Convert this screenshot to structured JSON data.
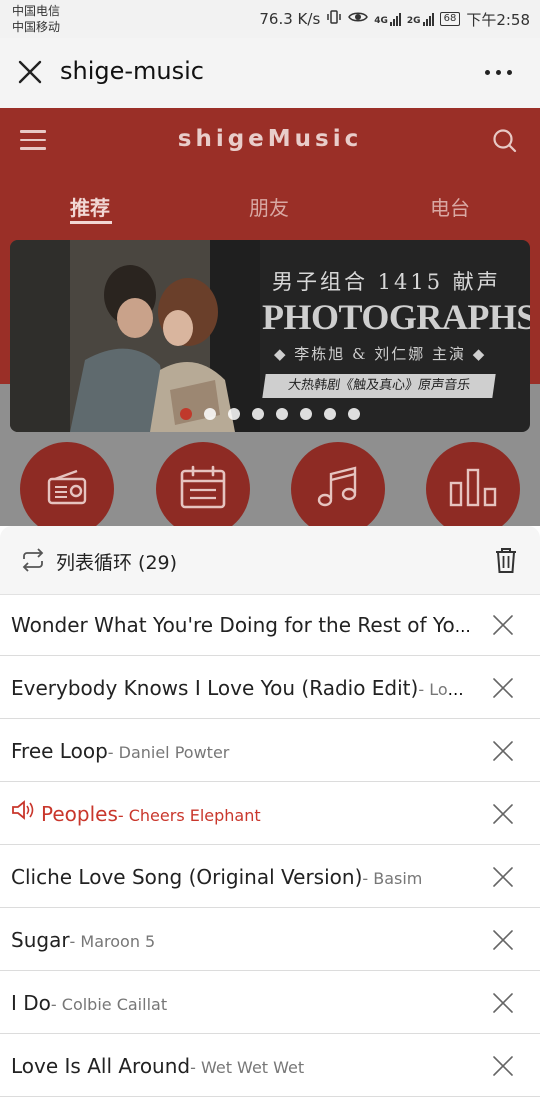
{
  "status_bar": {
    "carrier_1": "中国电信",
    "carrier_2": "中国移动",
    "speed": "76.3 K/s",
    "net_1": "4G",
    "net_2": "2G",
    "battery": "68",
    "time": "下午2:58"
  },
  "app_bar": {
    "title": "shige-music"
  },
  "header": {
    "brand": "shigeMusic"
  },
  "tabs": [
    {
      "label": "推荐",
      "active": true
    },
    {
      "label": "朋友",
      "active": false
    },
    {
      "label": "电台",
      "active": false
    }
  ],
  "banner": {
    "line1": "男子组合 1415 献声",
    "line2": "PHOTOGRAPHS",
    "line3": "◆ 李栋旭 & 刘仁娜 主演 ◆",
    "line4": "大热韩剧《触及真心》原声音乐",
    "slide_count": 8,
    "active_slide": 1
  },
  "categories": [
    {
      "icon": "radio-icon"
    },
    {
      "icon": "calendar-icon"
    },
    {
      "icon": "music-note-icon"
    },
    {
      "icon": "chart-bars-icon"
    }
  ],
  "playlist": {
    "mode_label": "列表循环 (29)",
    "items": [
      {
        "song": "Wonder What You're Doing for the Rest of Your ...",
        "artist": "",
        "playing": false
      },
      {
        "song": "Everybody Knows I Love You (Radio Edit)",
        "artist": "- Lovebu...",
        "playing": false
      },
      {
        "song": "Free Loop",
        "artist": "- Daniel Powter",
        "playing": false
      },
      {
        "song": "Peoples",
        "artist": "- Cheers Elephant",
        "playing": true
      },
      {
        "song": "Cliche Love Song (Original Version)",
        "artist": "- Basim",
        "playing": false
      },
      {
        "song": "Sugar",
        "artist": "- Maroon 5",
        "playing": false
      },
      {
        "song": "I Do",
        "artist": "- Colbie Caillat",
        "playing": false
      },
      {
        "song": "Love Is All Around",
        "artist": "- Wet Wet Wet",
        "playing": false
      }
    ]
  },
  "colors": {
    "accent": "#c9372c",
    "header_red": "#9a2f27"
  }
}
